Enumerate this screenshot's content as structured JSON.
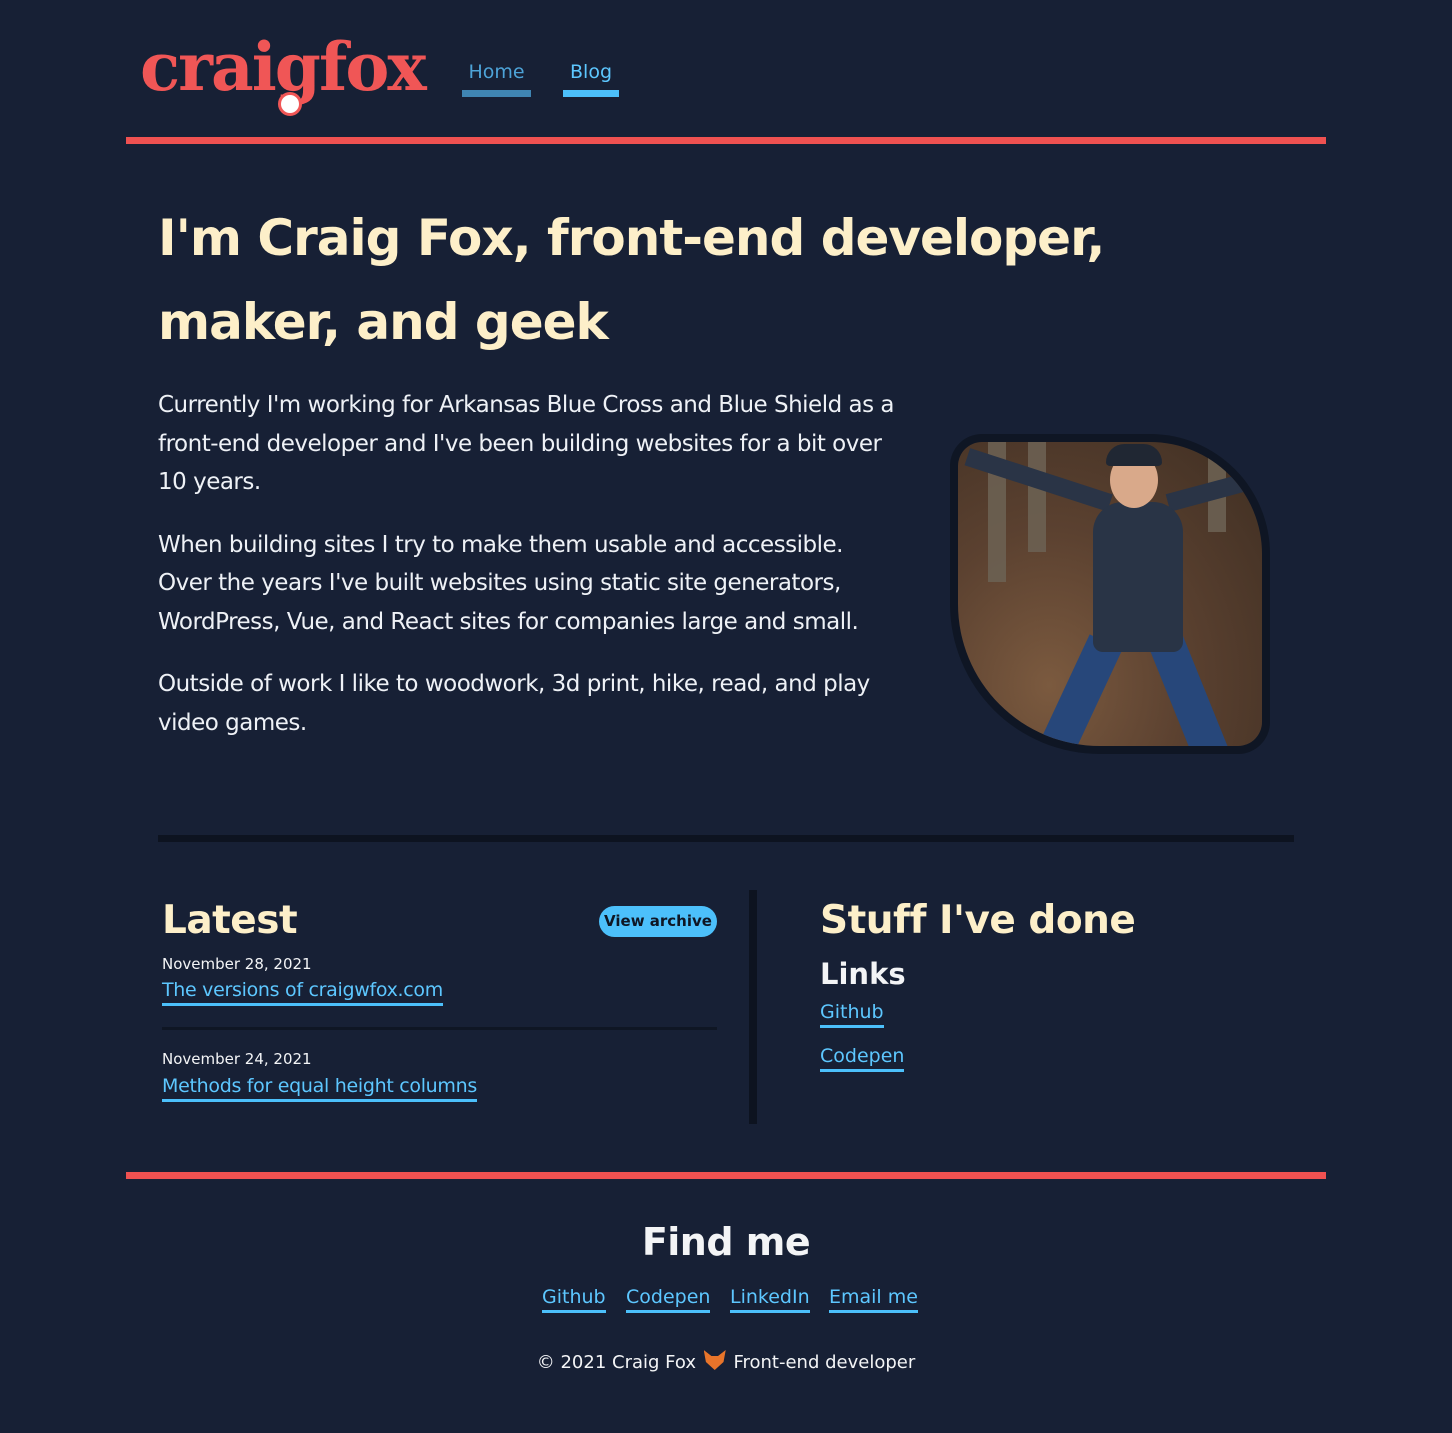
{
  "header": {
    "logo_text": "craigfox",
    "nav": [
      {
        "label": "Home"
      },
      {
        "label": "Blog"
      }
    ]
  },
  "hero": {
    "title": "I'm Craig Fox, front-end developer, maker, and geek",
    "paragraphs": [
      "Currently I'm working for Arkansas Blue Cross and Blue Shield as a front-end developer and I've been building websites for a bit over 10 years.",
      "When building sites I try to make them usable and accessible. Over the years I've built websites using static site generators, WordPress, Vue, and React sites for companies large and small.",
      "Outside of work I like to woodwork, 3d print, hike, read, and play video games."
    ]
  },
  "latest": {
    "title": "Latest",
    "archive_label": "View archive",
    "posts": [
      {
        "date": "November 28, 2021",
        "title": "The versions of craigwfox.com"
      },
      {
        "date": "November 24, 2021",
        "title": "Methods for equal height columns"
      }
    ]
  },
  "stuff": {
    "title": "Stuff I've done",
    "links_title": "Links",
    "links": [
      {
        "label": "Github"
      },
      {
        "label": "Codepen"
      }
    ]
  },
  "footer": {
    "title": "Find me",
    "links": [
      {
        "label": "Github"
      },
      {
        "label": "Codepen"
      },
      {
        "label": "LinkedIn"
      },
      {
        "label": "Email me"
      }
    ],
    "copyright_left": "© 2021 Craig Fox",
    "copyright_right": "Front-end developer",
    "fox_icon": "fox-icon"
  },
  "colors": {
    "background": "#172035",
    "accent_red": "#ef5151",
    "link_blue": "#5dc7ff",
    "heading_cream": "#fdefc9"
  }
}
